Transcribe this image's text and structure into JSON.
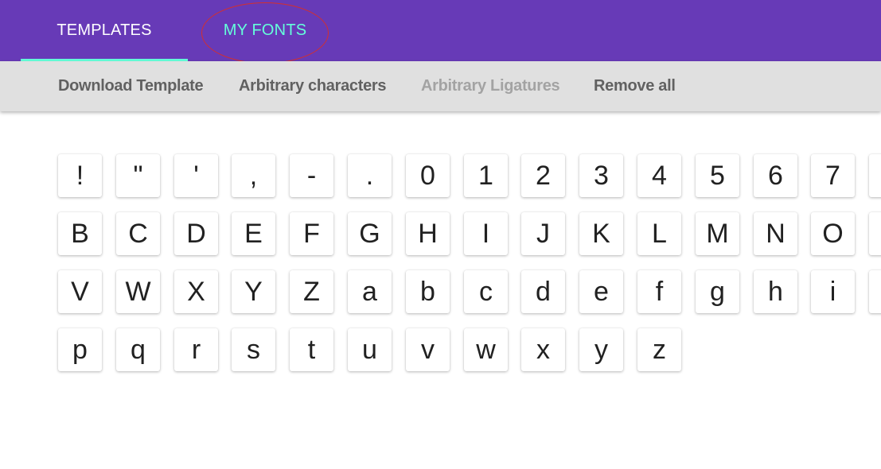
{
  "tabs": [
    {
      "label": "TEMPLATES",
      "active": true
    },
    {
      "label": "MY FONTS",
      "active": false,
      "annotated": true
    }
  ],
  "colors": {
    "appbar": "#673ab7",
    "accent": "#64ffda",
    "toolbar": "#e0e0e0",
    "annotation": "#d32f2f"
  },
  "toolbar": {
    "buttons": [
      {
        "label": "Download Template",
        "enabled": true
      },
      {
        "label": "Arbitrary characters",
        "enabled": true
      },
      {
        "label": "Arbitrary Ligatures",
        "enabled": false
      },
      {
        "label": "Remove all",
        "enabled": true
      }
    ]
  },
  "glyph_rows": [
    [
      "!",
      "\"",
      "'",
      ",",
      "-",
      ".",
      "0",
      "1",
      "2",
      "3",
      "4",
      "5",
      "6",
      "7",
      ""
    ],
    [
      "B",
      "C",
      "D",
      "E",
      "F",
      "G",
      "H",
      "I",
      "J",
      "K",
      "L",
      "M",
      "N",
      "O",
      ""
    ],
    [
      "V",
      "W",
      "X",
      "Y",
      "Z",
      "a",
      "b",
      "c",
      "d",
      "e",
      "f",
      "g",
      "h",
      "i",
      ""
    ],
    [
      "p",
      "q",
      "r",
      "s",
      "t",
      "u",
      "v",
      "w",
      "x",
      "y",
      "z"
    ]
  ]
}
